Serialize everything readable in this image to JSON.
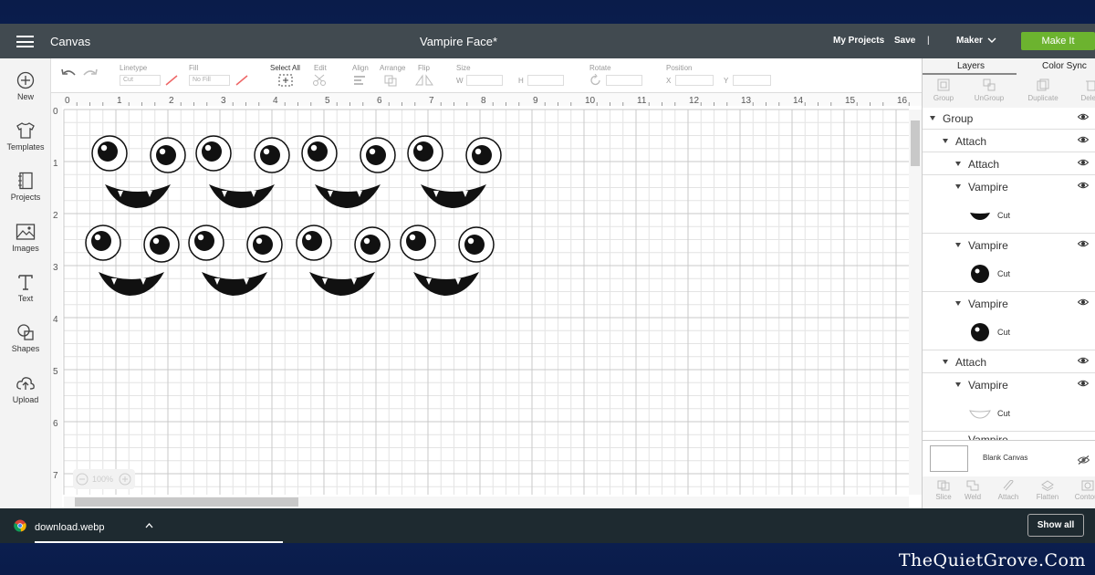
{
  "topbar": {
    "title": "Canvas",
    "project_name": "Vampire Face*",
    "my_projects": "My Projects",
    "save": "Save",
    "separator": "|",
    "machine": "Maker",
    "make_it": "Make It"
  },
  "leftbar": {
    "items": [
      {
        "label": "New",
        "icon": "plus-circle-icon"
      },
      {
        "label": "Templates",
        "icon": "shirt-icon"
      },
      {
        "label": "Projects",
        "icon": "notebook-icon"
      },
      {
        "label": "Images",
        "icon": "image-icon"
      },
      {
        "label": "Text",
        "icon": "text-t-icon"
      },
      {
        "label": "Shapes",
        "icon": "shapes-icon"
      },
      {
        "label": "Upload",
        "icon": "cloud-upload-icon"
      }
    ]
  },
  "toolbar": {
    "linetype_label": "Linetype",
    "linetype_value": "Cut",
    "fill_label": "Fill",
    "fill_value": "No Fill",
    "select_all": "Select All",
    "edit": "Edit",
    "align": "Align",
    "arrange": "Arrange",
    "flip": "Flip",
    "size": "Size",
    "size_w": "W",
    "size_h": "H",
    "rotate": "Rotate",
    "position": "Position",
    "pos_x": "X",
    "pos_y": "Y"
  },
  "canvas": {
    "ruler_top": [
      "0",
      "1",
      "2",
      "3",
      "4",
      "5",
      "6",
      "7",
      "8",
      "9",
      "10",
      "11",
      "12",
      "13",
      "14",
      "15",
      "16"
    ],
    "ruler_left": [
      "0",
      "1",
      "2",
      "3",
      "4",
      "5",
      "6",
      "7"
    ],
    "zoom": "100%"
  },
  "rightpanel": {
    "tab_layers": "Layers",
    "tab_color_sync": "Color Sync",
    "tools": [
      "Group",
      "UnGroup",
      "Duplicate",
      "Delete"
    ],
    "layers": [
      {
        "label": "Group"
      },
      {
        "label": "Attach"
      },
      {
        "label": "Attach"
      },
      {
        "label": "Vampire"
      },
      {
        "label": "Vampire"
      },
      {
        "label": "Vampire"
      },
      {
        "label": "Attach"
      },
      {
        "label": "Vampire"
      }
    ],
    "leaf_label": "Cut",
    "cut_partial": "Vampire",
    "blank_canvas": "Blank Canvas",
    "bottom_tools": [
      "Slice",
      "Weld",
      "Attach",
      "Flatten",
      "Contour"
    ]
  },
  "downloadbar": {
    "filename": "download.webp",
    "show_all": "Show all"
  },
  "watermark": "TheQuietGrove.Com"
}
